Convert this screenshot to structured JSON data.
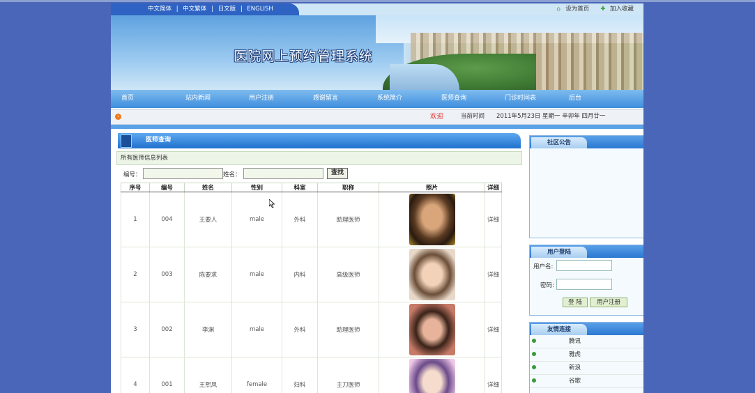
{
  "language_links": [
    "中文简体",
    "中文繁体",
    "日文版",
    "ENGLISH"
  ],
  "language_separator": "|",
  "top_links": [
    {
      "label": "设为首页",
      "icon": "home-icon"
    },
    {
      "label": "加入收藏",
      "icon": "plus-icon"
    }
  ],
  "banner_title": "医院网上预约管理系统",
  "nav": [
    "首页",
    "站内新闻",
    "用户注册",
    "感谢留言",
    "系统简介",
    "医师查询",
    "门诊时间表",
    "后台"
  ],
  "welcome": {
    "greeting": "欢迎",
    "time_label": "当前时间",
    "date_text": "2011年5月23日 星期一 辛卯年 四月廿一"
  },
  "section": {
    "title": "医师查询",
    "list_header": "所有医师信息列表",
    "search": {
      "id_label": "编号：",
      "name_label": "姓名：",
      "button": "查找"
    }
  },
  "table": {
    "columns": [
      "序号",
      "编号",
      "姓名",
      "性别",
      "科室",
      "职称",
      "照片",
      "详细"
    ],
    "rows": [
      {
        "seq": "1",
        "id": "004",
        "name": "王要人",
        "gender": "male",
        "dept": "外科",
        "title": "助理医师",
        "detail": "详细"
      },
      {
        "seq": "2",
        "id": "003",
        "name": "陈要求",
        "gender": "male",
        "dept": "内科",
        "title": "高级医师",
        "detail": "详细"
      },
      {
        "seq": "3",
        "id": "002",
        "name": "李渊",
        "gender": "male",
        "dept": "外科",
        "title": "助理医师",
        "detail": "详细"
      },
      {
        "seq": "4",
        "id": "001",
        "name": "王熙凤",
        "gender": "female",
        "dept": "妇科",
        "title": "主刀医师",
        "detail": "详细"
      }
    ]
  },
  "sidebar": {
    "notice_title": "社区公告",
    "login": {
      "title": "用户登陆",
      "username_label": "用户名:",
      "password_label": "密码:",
      "login_button": "登 陆",
      "register_button": "用户注册"
    },
    "links": {
      "title": "友情连接",
      "items": [
        "腾讯",
        "雅虎",
        "新浪",
        "谷歌"
      ]
    }
  },
  "colors": {
    "background": "#4a66b8",
    "nav": "#3f8ede",
    "greeting": "#e0302a"
  }
}
